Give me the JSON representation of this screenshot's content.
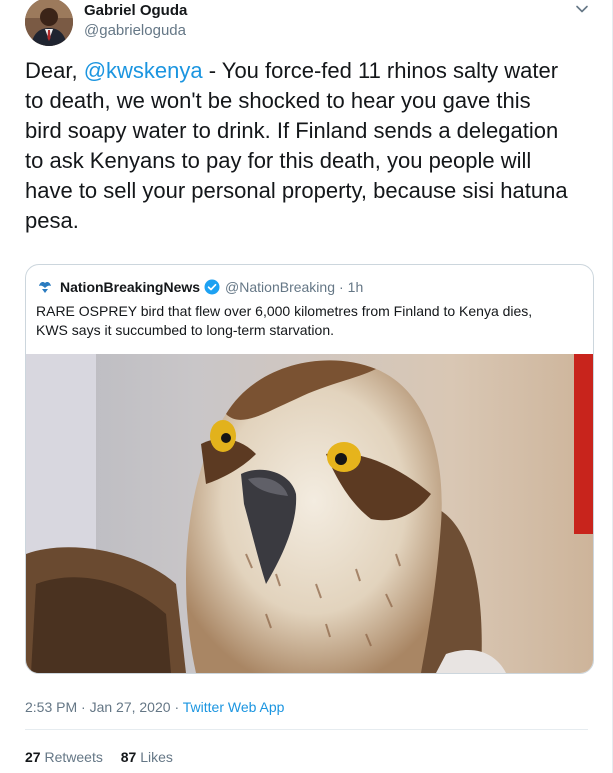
{
  "author": {
    "name": "Gabriel Oguda",
    "handle": "@gabrieloguda"
  },
  "tweet": {
    "line1_pre": "Dear, ",
    "mention": "@kwskenya",
    "line1_post": " - You force-fed 11 rhinos salty water",
    "line2": "to death, we won't be shocked to hear you gave this",
    "line3": "bird soapy water to drink. If Finland sends a delegation",
    "line4": "to ask Kenyans to pay for this death, you people will",
    "line5": "have to sell your personal property, because sisi hatuna",
    "line6": "pesa."
  },
  "quoted": {
    "name": "NationBreakingNews",
    "handle": "@NationBreaking",
    "separator": "·",
    "time": "1h",
    "line1": "RARE OSPREY bird that flew over 6,000 kilometres from Finland to Kenya dies,",
    "line2": "KWS says it succumbed to long-term starvation.",
    "verified_color": "#1da1f2"
  },
  "meta": {
    "timestamp": "2:53 PM · Jan 27, 2020",
    "separator": "·",
    "app": "Twitter Web App"
  },
  "stats": {
    "retweets_count": "27",
    "retweets_label": "Retweets",
    "likes_count": "87",
    "likes_label": "Likes"
  },
  "colors": {
    "link": "#1b95e0",
    "secondary_text": "#657786",
    "border": "#ccd6dd"
  },
  "icons": {
    "menu": "chevron-down-icon",
    "verified": "verified-badge-icon"
  }
}
